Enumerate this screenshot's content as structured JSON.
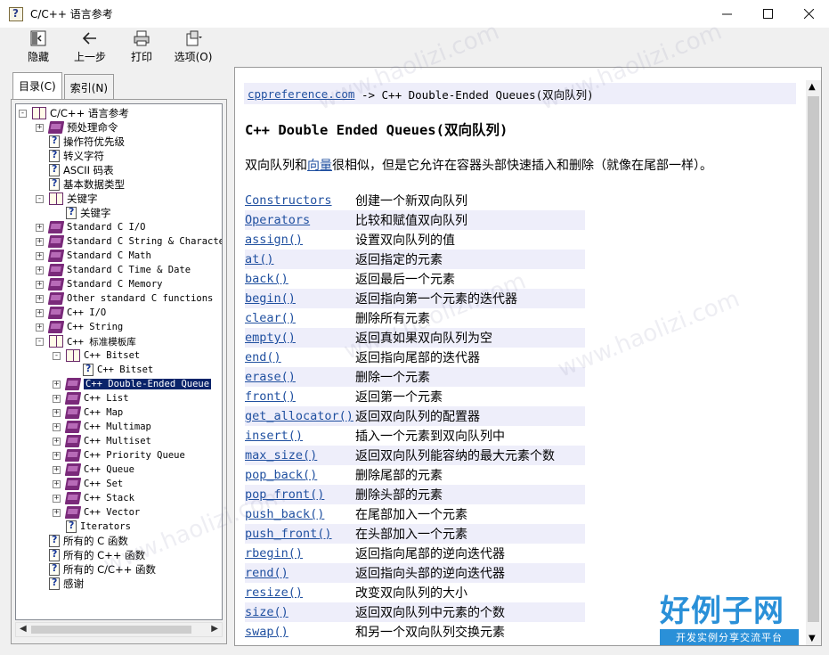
{
  "window": {
    "title": "C/C++ 语言参考"
  },
  "toolbar": {
    "items": [
      {
        "label": "隐藏",
        "icon": "hide-icon"
      },
      {
        "label": "上一步",
        "icon": "back-arrow-icon"
      },
      {
        "label": "打印",
        "icon": "printer-icon"
      },
      {
        "label": "选项(O)",
        "icon": "options-icon"
      }
    ]
  },
  "nav_tabs": {
    "contents": "目录(C)",
    "index": "索引(N)"
  },
  "tree": [
    {
      "indent": 0,
      "exp": "-",
      "icon": "book-open",
      "text": "C/C++ 语言参考",
      "cn": true
    },
    {
      "indent": 1,
      "exp": "+",
      "icon": "book-closed",
      "text": "预处理命令",
      "cn": true
    },
    {
      "indent": 1,
      "exp": "",
      "icon": "page",
      "text": "操作符优先级",
      "cn": true
    },
    {
      "indent": 1,
      "exp": "",
      "icon": "page",
      "text": "转义字符",
      "cn": true
    },
    {
      "indent": 1,
      "exp": "",
      "icon": "page",
      "text": "ASCII 码表",
      "cn": true
    },
    {
      "indent": 1,
      "exp": "",
      "icon": "page",
      "text": "基本数据类型",
      "cn": true
    },
    {
      "indent": 1,
      "exp": "-",
      "icon": "book-open",
      "text": "关键字",
      "cn": true
    },
    {
      "indent": 2,
      "exp": "",
      "icon": "page",
      "text": "关键字",
      "cn": true
    },
    {
      "indent": 1,
      "exp": "+",
      "icon": "book-closed",
      "text": "Standard C I/O"
    },
    {
      "indent": 1,
      "exp": "+",
      "icon": "book-closed",
      "text": "Standard C String & Character"
    },
    {
      "indent": 1,
      "exp": "+",
      "icon": "book-closed",
      "text": "Standard C Math"
    },
    {
      "indent": 1,
      "exp": "+",
      "icon": "book-closed",
      "text": "Standard C Time & Date"
    },
    {
      "indent": 1,
      "exp": "+",
      "icon": "book-closed",
      "text": "Standard C Memory"
    },
    {
      "indent": 1,
      "exp": "+",
      "icon": "book-closed",
      "text": "Other standard C functions"
    },
    {
      "indent": 1,
      "exp": "+",
      "icon": "book-closed",
      "text": "C++ I/O"
    },
    {
      "indent": 1,
      "exp": "+",
      "icon": "book-closed",
      "text": "C++ String"
    },
    {
      "indent": 1,
      "exp": "-",
      "icon": "book-open",
      "text": "C++ 标准模板库"
    },
    {
      "indent": 2,
      "exp": "-",
      "icon": "book-open",
      "text": "C++ Bitset"
    },
    {
      "indent": 3,
      "exp": "",
      "icon": "page",
      "text": "C++ Bitset"
    },
    {
      "indent": 2,
      "exp": "+",
      "icon": "book-closed",
      "text": "C++ Double-Ended Queue",
      "selected": true
    },
    {
      "indent": 2,
      "exp": "+",
      "icon": "book-closed",
      "text": "C++ List"
    },
    {
      "indent": 2,
      "exp": "+",
      "icon": "book-closed",
      "text": "C++ Map"
    },
    {
      "indent": 2,
      "exp": "+",
      "icon": "book-closed",
      "text": "C++ Multimap"
    },
    {
      "indent": 2,
      "exp": "+",
      "icon": "book-closed",
      "text": "C++ Multiset"
    },
    {
      "indent": 2,
      "exp": "+",
      "icon": "book-closed",
      "text": "C++ Priority Queue"
    },
    {
      "indent": 2,
      "exp": "+",
      "icon": "book-closed",
      "text": "C++ Queue"
    },
    {
      "indent": 2,
      "exp": "+",
      "icon": "book-closed",
      "text": "C++ Set"
    },
    {
      "indent": 2,
      "exp": "+",
      "icon": "book-closed",
      "text": "C++ Stack"
    },
    {
      "indent": 2,
      "exp": "+",
      "icon": "book-closed",
      "text": "C++ Vector"
    },
    {
      "indent": 2,
      "exp": "",
      "icon": "page",
      "text": "Iterators"
    },
    {
      "indent": 1,
      "exp": "",
      "icon": "page",
      "text": "所有的 C 函数",
      "cn": true
    },
    {
      "indent": 1,
      "exp": "",
      "icon": "page",
      "text": "所有的 C++ 函数",
      "cn": true
    },
    {
      "indent": 1,
      "exp": "",
      "icon": "page",
      "text": "所有的 C/C++ 函数",
      "cn": true
    },
    {
      "indent": 1,
      "exp": "",
      "icon": "page",
      "text": "感谢",
      "cn": true
    }
  ],
  "content": {
    "breadcrumb_link": "cppreference.com",
    "breadcrumb_rest": " -> C++ Double-Ended Queues(双向队列)",
    "heading": "C++ Double Ended Queues(双向队列)",
    "intro_before": "双向队列和",
    "intro_link": "向量",
    "intro_after": "很相似，但是它允许在容器头部快速插入和删除（就像在尾部一样）。",
    "functions": [
      {
        "name": "Constructors",
        "desc": "创建一个新双向队列"
      },
      {
        "name": "Operators",
        "desc": "比较和赋值双向队列"
      },
      {
        "name": "assign()",
        "desc": "设置双向队列的值"
      },
      {
        "name": "at()",
        "desc": "返回指定的元素"
      },
      {
        "name": "back()",
        "desc": "返回最后一个元素"
      },
      {
        "name": "begin()",
        "desc": "返回指向第一个元素的迭代器"
      },
      {
        "name": "clear()",
        "desc": "删除所有元素"
      },
      {
        "name": "empty()",
        "desc": "返回真如果双向队列为空"
      },
      {
        "name": "end()",
        "desc": "返回指向尾部的迭代器"
      },
      {
        "name": "erase()",
        "desc": "删除一个元素"
      },
      {
        "name": "front()",
        "desc": "返回第一个元素"
      },
      {
        "name": "get_allocator()",
        "desc": "返回双向队列的配置器"
      },
      {
        "name": "insert()",
        "desc": "插入一个元素到双向队列中"
      },
      {
        "name": "max_size()",
        "desc": "返回双向队列能容纳的最大元素个数"
      },
      {
        "name": "pop_back()",
        "desc": "删除尾部的元素"
      },
      {
        "name": "pop_front()",
        "desc": "删除头部的元素"
      },
      {
        "name": "push_back()",
        "desc": "在尾部加入一个元素"
      },
      {
        "name": "push_front()",
        "desc": "在头部加入一个元素"
      },
      {
        "name": "rbegin()",
        "desc": "返回指向尾部的逆向迭代器"
      },
      {
        "name": "rend()",
        "desc": "返回指向头部的逆向迭代器"
      },
      {
        "name": "resize()",
        "desc": "改变双向队列的大小"
      },
      {
        "name": "size()",
        "desc": "返回双向队列中元素的个数"
      },
      {
        "name": "swap()",
        "desc": "和另一个双向队列交换元素"
      }
    ]
  },
  "watermark": {
    "text": "www.haolizi.com",
    "logo_title": "好例子网",
    "logo_subtitle": "开发实例分享交流平台"
  }
}
